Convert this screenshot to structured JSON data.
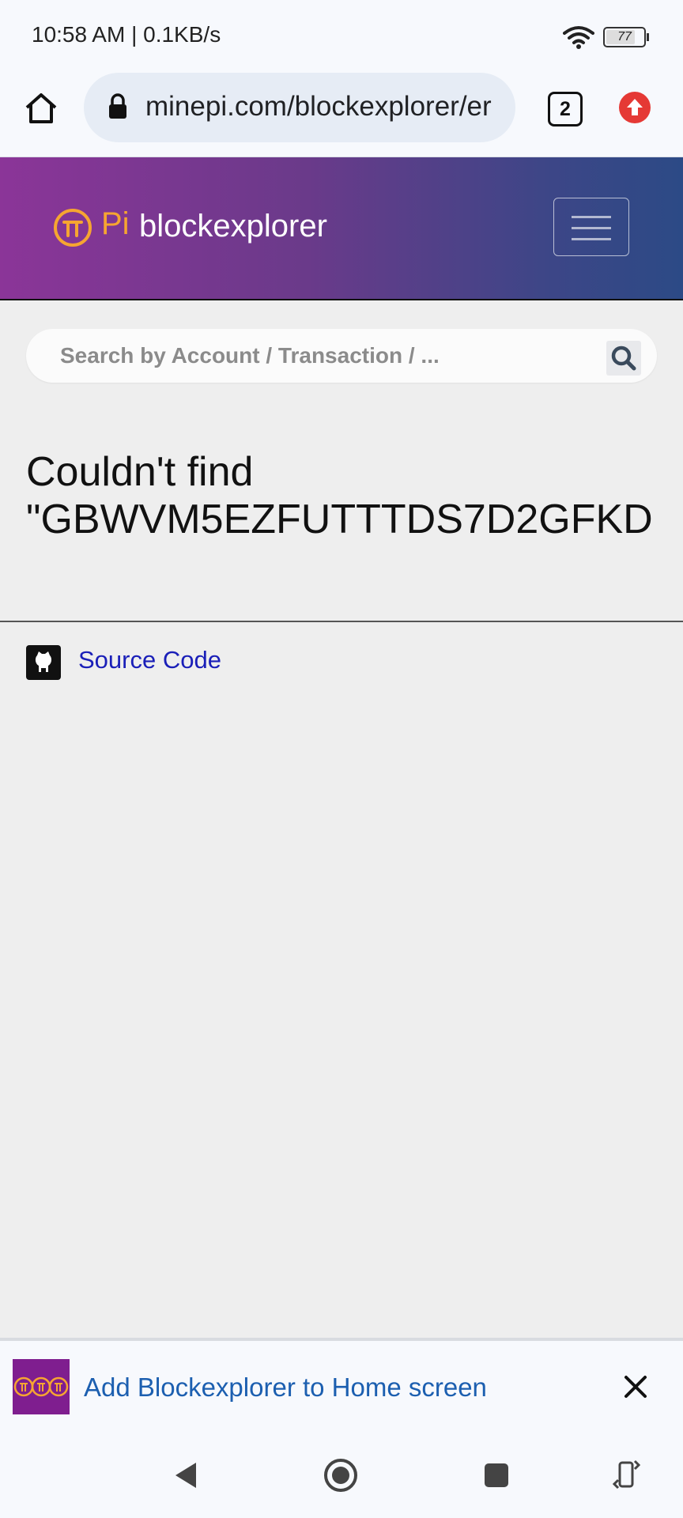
{
  "status_bar": {
    "time_speed": "10:58 AM | 0.1KB/s",
    "battery": "77"
  },
  "browser": {
    "url": "minepi.com/blockexplorer/er",
    "tab_count": "2",
    "icons": [
      "home-icon",
      "lock-icon",
      "tabs-icon",
      "update-icon"
    ]
  },
  "site": {
    "logo_pi": "Pi",
    "logo_text": "blockexplorer",
    "brand_color": "#f6a531",
    "search": {
      "placeholder": "Search by Account / Transaction / ..."
    }
  },
  "main": {
    "heading_line1": "Couldn't find",
    "heading_line2": "\"GBWVM5EZFUTTTDS7D2GFKD",
    "source_link": "Source Code"
  },
  "add_to_home": {
    "text": "Add Blockexplorer to Home screen",
    "accent_color": "#1c5fb0"
  },
  "nav_bar": {
    "icons": [
      "back-icon",
      "home-circle-icon",
      "recents-icon",
      "rotate-icon"
    ]
  }
}
